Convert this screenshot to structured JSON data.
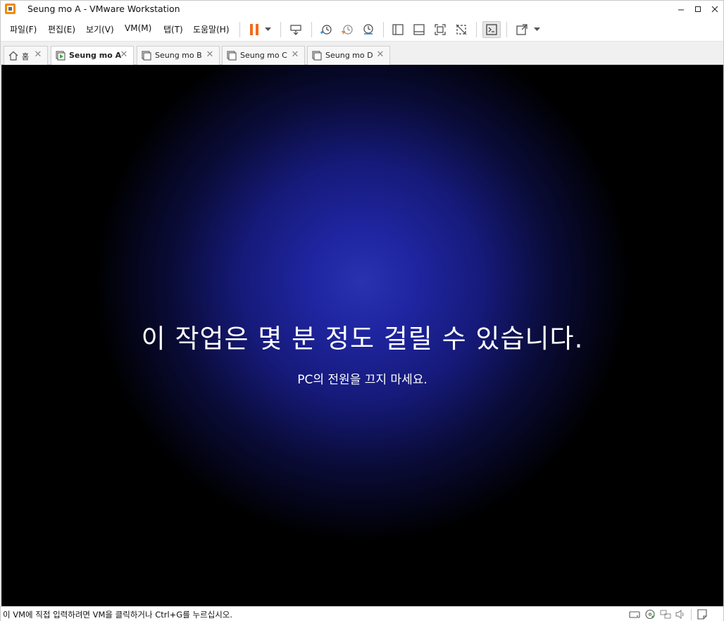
{
  "window": {
    "title": "Seung mo A - VMware Workstation"
  },
  "menu": {
    "items": [
      "파일(F)",
      "편집(E)",
      "보기(V)",
      "VM(M)",
      "탭(T)",
      "도움말(H)"
    ]
  },
  "toolbar": {
    "icons": [
      "pause-icon",
      "dropdown-arrow-icon",
      "send-ctrl-alt-del-icon",
      "snapshot-take-icon",
      "snapshot-revert-icon",
      "snapshot-manager-icon",
      "library-view-icon",
      "thumbnail-bar-icon",
      "fullscreen-icon",
      "unity-icon",
      "console-view-icon",
      "stretch-guest-icon",
      "dropdown-arrow-icon"
    ],
    "accent_color": "#f26b1d"
  },
  "tabs": [
    {
      "label": "홈",
      "active": false,
      "icon": "home-icon"
    },
    {
      "label": "Seung mo A",
      "active": true,
      "icon": "vm-running-icon"
    },
    {
      "label": "Seung mo B",
      "active": false,
      "icon": "vm-icon"
    },
    {
      "label": "Seung mo C",
      "active": false,
      "icon": "vm-icon"
    },
    {
      "label": "Seung mo D",
      "active": false,
      "icon": "vm-icon"
    }
  ],
  "console": {
    "headline": "이 작업은 몇 분 정도 걸릴 수 있습니다.",
    "subline": "PC의 전원을 끄지 마세요.",
    "background_color": "#1f25a0"
  },
  "statusbar": {
    "message": "이 VM에 직접 입력하려면 VM을 클릭하거나 Ctrl+G를 누르십시오.",
    "icons": [
      "hard-disk-icon",
      "cd-dvd-icon",
      "network-icon",
      "sound-icon",
      "message-log-icon"
    ]
  }
}
